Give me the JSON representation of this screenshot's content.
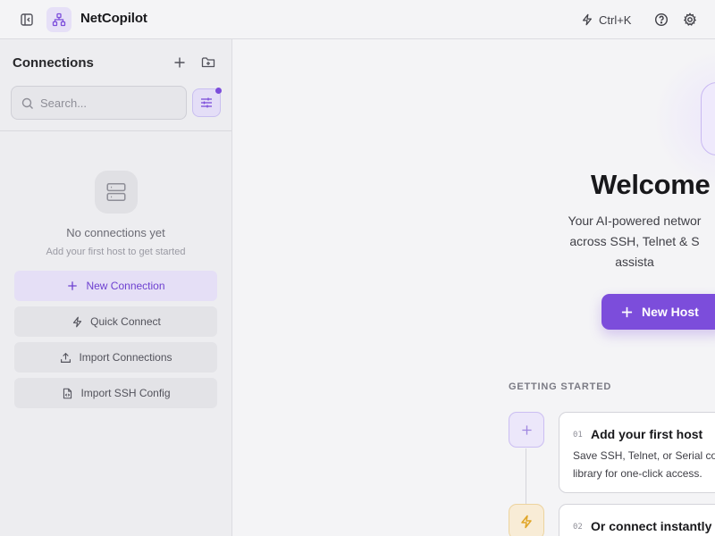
{
  "topbar": {
    "app_title": "NetCopilot",
    "command_shortcut": "Ctrl+K",
    "icons": {
      "toggle": "sidebar-toggle-icon",
      "logo": "network-icon",
      "command": "bolt-icon",
      "help": "help-circle-icon",
      "settings": "gear-icon"
    }
  },
  "sidebar": {
    "title": "Connections",
    "search_placeholder": "Search...",
    "filter_active": true,
    "empty_state": {
      "title": "No connections yet",
      "subtitle": "Add your first host to get started"
    },
    "buttons": [
      {
        "label": "New Connection",
        "icon": "plus-icon",
        "primary": true
      },
      {
        "label": "Quick Connect",
        "icon": "bolt-icon",
        "primary": false
      },
      {
        "label": "Import Connections",
        "icon": "upload-icon",
        "primary": false
      },
      {
        "label": "Import SSH Config",
        "icon": "file-code-icon",
        "primary": false
      }
    ]
  },
  "main": {
    "welcome_title": "Welcome",
    "tagline_lines": [
      "Your AI-powered networ",
      "across SSH, Telnet & S",
      "assista"
    ],
    "new_host_label": "New Host",
    "getting_started_label": "GETTING STARTED",
    "steps": [
      {
        "number": "01",
        "title": "Add your first host",
        "desc_lines": [
          "Save SSH, Telnet, or Serial co",
          "library for one-click access."
        ]
      },
      {
        "number": "02",
        "title": "Or connect instantly",
        "desc_lines": []
      }
    ]
  },
  "colors": {
    "accent": "#7c4ddb",
    "accent_soft": "#e5dff6",
    "warning_soft": "#f8ecd6",
    "warning_icon": "#e0a526"
  }
}
